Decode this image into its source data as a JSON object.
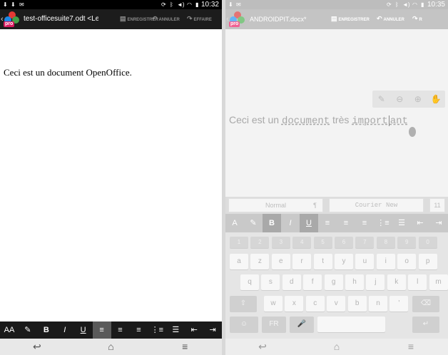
{
  "left": {
    "status": {
      "clock": "10:32"
    },
    "appbar": {
      "title": "test-officesuite7.odt <Le",
      "save_label": "ENREGISTRER",
      "undo_label": "ANNULER",
      "redo_label": "EFFAIRE",
      "logo_badge": "pro"
    },
    "document": {
      "text": "Ceci est un document OpenOffice."
    },
    "format_toolbar": [
      "AA",
      "✎",
      "B",
      "I",
      "U",
      "≡",
      "≡",
      "≡",
      "⋮≡",
      "☰",
      "⇤",
      "⇥"
    ]
  },
  "right": {
    "status": {
      "clock": "10:35"
    },
    "appbar": {
      "title": "ANDROIDPIT.docx*",
      "save_label": "ENREGISTRER",
      "undo_label": "ANNULER",
      "redo_label": "R",
      "logo_badge": "pro"
    },
    "document": {
      "part1": "Ceci est un ",
      "part2": "document",
      "part3": " très ",
      "part4": "import",
      "part5": "ant"
    },
    "styles": {
      "paragraph_style": "Normal",
      "pilcrow": "¶",
      "font": "Courier New",
      "size": "11"
    },
    "format_toolbar": [
      "A",
      "✎",
      "B",
      "I",
      "U",
      "≡",
      "≡",
      "≡",
      "⋮≡",
      "☰",
      "⇤",
      "⇥"
    ],
    "keyboard": {
      "numbers": [
        "1",
        "2",
        "3",
        "4",
        "5",
        "6",
        "7",
        "8",
        "9",
        "0"
      ],
      "row1": [
        "a",
        "z",
        "e",
        "r",
        "t",
        "y",
        "u",
        "i",
        "o",
        "p"
      ],
      "row2": [
        "q",
        "s",
        "d",
        "f",
        "g",
        "h",
        "j",
        "k",
        "l",
        "m"
      ],
      "row3": [
        "w",
        "x",
        "c",
        "v",
        "b",
        "n"
      ],
      "lang": "FR",
      "shift": "⇧",
      "backspace": "⌫",
      "enter": "↵",
      "quote": "'",
      "emoji": "☺",
      "mic": "🎤"
    }
  },
  "navbar": {
    "back": "↩",
    "home": "⌂",
    "menu": "≡"
  },
  "colors": {
    "left_toolbar": "#1a1a1a",
    "right_toolbar": "#c9c9c9",
    "status_bar": "#000000"
  }
}
